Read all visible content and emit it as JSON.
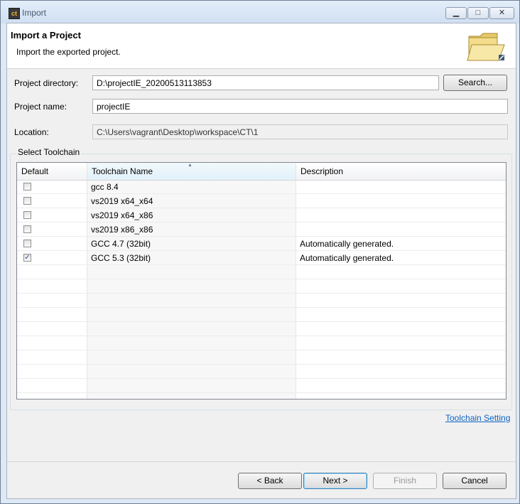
{
  "window": {
    "title": "Import",
    "app_icon_text": "ct",
    "controls": {
      "minimize": "▁",
      "maximize": "□",
      "close": "✕"
    }
  },
  "header": {
    "title": "Import a Project",
    "description": "Import the exported project.",
    "icon": "folder-open-icon"
  },
  "form": {
    "project_directory_label": "Project directory:",
    "project_directory_value": "D:\\projectIE_20200513113853",
    "search_button": "Search...",
    "project_name_label": "Project name:",
    "project_name_value": "projectIE",
    "location_label": "Location:",
    "location_value": "C:\\Users\\vagrant\\Desktop\\workspace\\CT\\1"
  },
  "toolchain": {
    "group_title": "Select Toolchain",
    "columns": [
      "Default",
      "Toolchain Name",
      "Description"
    ],
    "sorted_column": "Toolchain Name",
    "rows": [
      {
        "checked": false,
        "name": "gcc 8.4",
        "description": ""
      },
      {
        "checked": false,
        "name": "vs2019 x64_x64",
        "description": ""
      },
      {
        "checked": false,
        "name": "vs2019 x64_x86",
        "description": ""
      },
      {
        "checked": false,
        "name": "vs2019 x86_x86",
        "description": ""
      },
      {
        "checked": false,
        "name": "GCC 4.7 (32bit)",
        "description": "Automatically generated."
      },
      {
        "checked": true,
        "name": "GCC 5.3 (32bit)",
        "description": "Automatically generated."
      }
    ],
    "empty_rows": 9,
    "setting_link": "Toolchain Setting"
  },
  "buttons": {
    "back": "< Back",
    "next": "Next >",
    "finish": "Finish",
    "cancel": "Cancel"
  },
  "colors": {
    "title_bar": "#dfe9f5",
    "link": "#0b63c3",
    "dialog_bg": "#f0f0f0"
  }
}
